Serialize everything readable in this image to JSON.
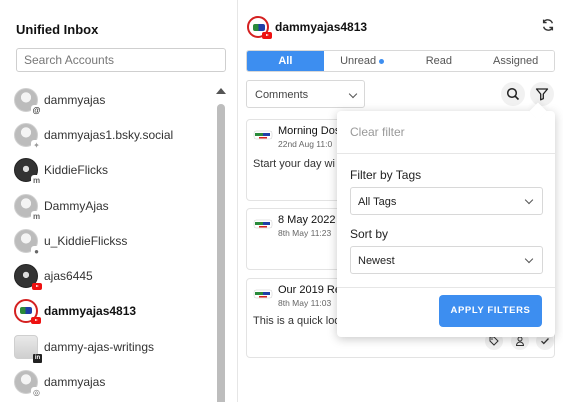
{
  "sidebar": {
    "title": "Unified Inbox",
    "search_placeholder": "Search Accounts",
    "accounts": [
      {
        "name": "dammyajas",
        "platform": "threads-icon"
      },
      {
        "name": "dammyajas1.bsky.social",
        "platform": "bluesky-icon"
      },
      {
        "name": "KiddieFlicks",
        "platform": "mastodon-icon"
      },
      {
        "name": "DammyAjas",
        "platform": "mastodon-icon"
      },
      {
        "name": "u_KiddieFlickss",
        "platform": "reddit-icon"
      },
      {
        "name": "ajas6445",
        "platform": "youtube-icon"
      },
      {
        "name": "dammyajas4813",
        "platform": "youtube-icon",
        "active": true
      },
      {
        "name": "dammy-ajas-writings",
        "platform": "linkedin-icon"
      },
      {
        "name": "dammyajas",
        "platform": "instagram-icon"
      }
    ]
  },
  "main": {
    "account_name": "dammyajas4813",
    "tabs": [
      {
        "label": "All",
        "active": true
      },
      {
        "label": "Unread",
        "unread_dot": true
      },
      {
        "label": "Read"
      },
      {
        "label": "Assigned"
      }
    ],
    "type_filter": "Comments",
    "cards": [
      {
        "title": "Morning Dos",
        "date": "22nd Aug 11:0",
        "body": "Start your day wi"
      },
      {
        "title": "8 May 2022",
        "date": "8th May 11:23"
      },
      {
        "title": "Our 2019 Re",
        "date": "8th May 11:03",
        "body": "This is a quick loo"
      }
    ]
  },
  "filter_popover": {
    "clear_label": "Clear filter",
    "tags_label": "Filter by Tags",
    "tags_value": "All Tags",
    "sort_label": "Sort by",
    "sort_value": "Newest",
    "apply_label": "APPLY FILTERS"
  },
  "colors": {
    "accent": "#3d8ef0",
    "youtube": "#e11111"
  }
}
